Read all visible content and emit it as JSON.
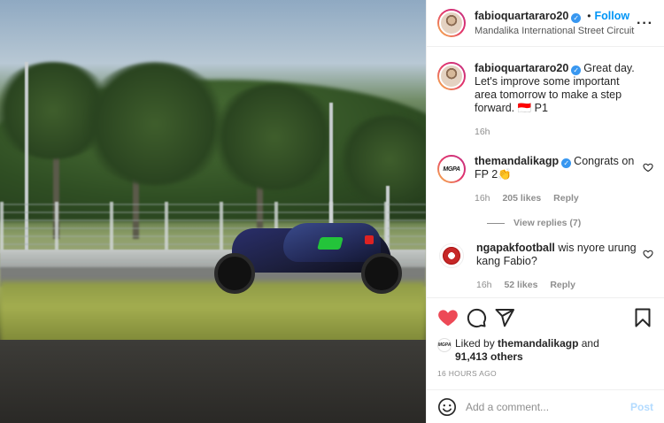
{
  "header": {
    "username": "fabioquartararo20",
    "separator": "•",
    "follow_label": "Follow",
    "location": "Mandalika International Street Circuit",
    "more_icon": "more-horizontal-icon"
  },
  "caption": {
    "username": "fabioquartararo20",
    "text": "Great day. Let's improve some important area tomorrow to make a step forward. 🇮🇩 P1",
    "time": "16h"
  },
  "comments": [
    {
      "username": "themandalikagp",
      "avatar_text": "MGPA",
      "text": "Congrats on FP 2👏",
      "time": "16h",
      "likes": "205 likes",
      "reply_label": "Reply",
      "view_replies": "View replies (7)"
    },
    {
      "username": "ngapakfootball",
      "text": "wis nyore urung kang Fabio?",
      "time": "16h",
      "likes": "52 likes",
      "reply_label": "Reply"
    }
  ],
  "actions": {
    "like_color": "#ed4956",
    "liked_by_prefix": "Liked by",
    "liked_by_user": "themandalikagp",
    "liked_by_and": "and",
    "others": "91,413 others",
    "timestamp": "16 HOURS AGO",
    "mini_avatar_text": "MGPA"
  },
  "add_comment": {
    "placeholder": "Add a comment...",
    "post_label": "Post"
  }
}
